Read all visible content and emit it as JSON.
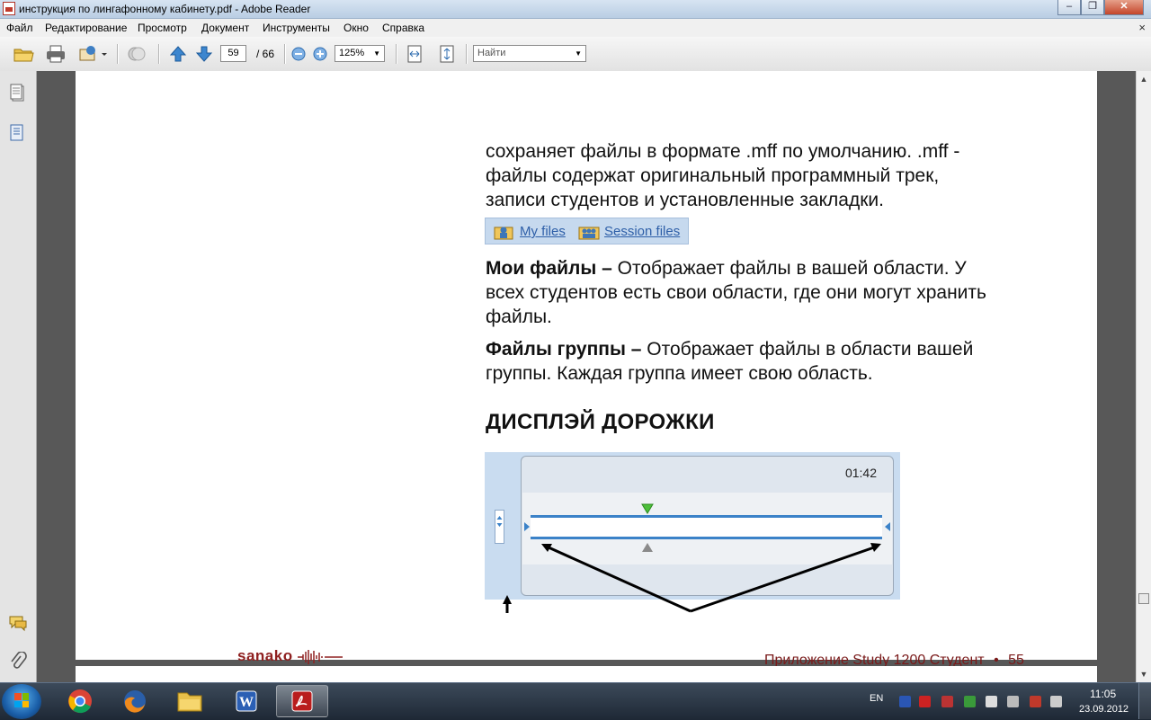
{
  "window": {
    "title": "инструкция по лингафонному кабинету.pdf - Adobe Reader",
    "minimize": "–",
    "restore": "❐",
    "close": "✕"
  },
  "menu": {
    "items": [
      "Файл",
      "Редактирование",
      "Просмотр",
      "Документ",
      "Инструменты",
      "Окно",
      "Справка"
    ],
    "close_glyph": "×"
  },
  "toolbar": {
    "page_current": "59",
    "page_total": "/ 66",
    "zoom": "125%",
    "find_placeholder": "Найти"
  },
  "content": {
    "intro_lines": [
      "сохраняет файлы в формате .mff по умолчанию. .mff -",
      "файлы содержат оригинальный программный трек,",
      "записи студентов и установленные закладки."
    ],
    "file_buttons": [
      "My files",
      "Session files"
    ],
    "my_files_term": "Мои файлы –",
    "my_files_lines": [
      " Отображает файлы в вашей области. У",
      "всех студентов есть свои области, где они могут хранить",
      "файлы."
    ],
    "group_files_term": "Файлы группы –",
    "group_files_lines": [
      " Отображает файлы в области вашей",
      "группы. Каждая группа имеет свою область."
    ],
    "heading": "ДИСПЛЭЙ ДОРОЖКИ",
    "track_time": "01:42"
  },
  "footer": {
    "logo": "sanako",
    "text": "Приложение Study 1200 Студент",
    "bullet": "•",
    "page_number": "55"
  },
  "taskbar": {
    "lang": "EN",
    "time": "11:05",
    "date": "23.09.2012"
  },
  "colors": {
    "accent": "#3b82c8",
    "footer": "#7a1a1a"
  }
}
